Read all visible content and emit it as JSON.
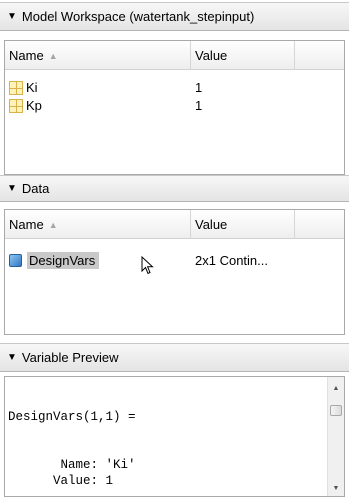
{
  "model_workspace": {
    "title": "Model Workspace (watertank_stepinput)",
    "columns": {
      "name": "Name",
      "value": "Value"
    },
    "rows": [
      {
        "name": "Ki",
        "value": "1",
        "icon": "matrix-icon"
      },
      {
        "name": "Kp",
        "value": "1",
        "icon": "matrix-icon"
      }
    ]
  },
  "data_panel": {
    "title": "Data",
    "columns": {
      "name": "Name",
      "value": "Value"
    },
    "rows": [
      {
        "name": "DesignVars",
        "value": "2x1 Contin...",
        "icon": "object-icon",
        "selected": true
      }
    ]
  },
  "variable_preview": {
    "title": "Variable Preview",
    "lines": [
      "",
      "",
      "DesignVars(1,1) =",
      "",
      "",
      "       Name: 'Ki'",
      "      Value: 1"
    ]
  },
  "colors": {
    "selection": "#c9c9c9",
    "icon_blue": "#2f77c4",
    "icon_yellow": "#fff2b8"
  }
}
